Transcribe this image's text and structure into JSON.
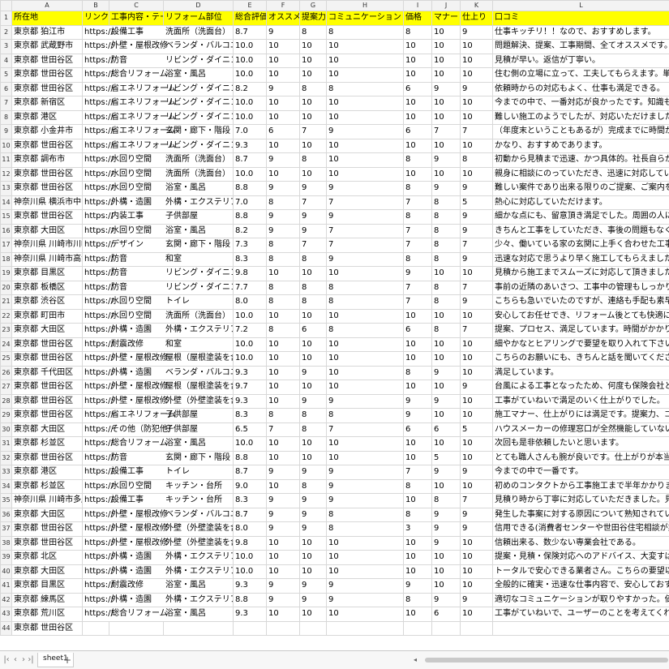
{
  "sheet": {
    "col_letters": [
      "A",
      "B",
      "C",
      "D",
      "E",
      "F",
      "G",
      "H",
      "I",
      "J",
      "K",
      "L"
    ],
    "headers": [
      "所在地",
      "リンク",
      "工事内容・テーマ",
      "リフォーム部位",
      "総合評価",
      "オススメ度",
      "提案力",
      "コミュニケーション",
      "価格",
      "マナー",
      "仕上り",
      "口コミ"
    ],
    "rows": [
      [
        "東京都 狛江市",
        "https://",
        "設備工事",
        "洗面所（洗面台）",
        "8.7",
        "9",
        "8",
        "8",
        "8",
        "10",
        "9",
        "仕事キッチリ！！なので、おすすめします。"
      ],
      [
        "東京都 武蔵野市",
        "https://",
        "外壁・屋根改修",
        "ベランダ・バルコニー",
        "10.0",
        "10",
        "10",
        "10",
        "10",
        "10",
        "10",
        "問題解決、提案、工事期間、全てオススメです。信用出来ます。"
      ],
      [
        "東京都 世田谷区",
        "https://",
        "防音",
        "リビング・ダイニング",
        "10.0",
        "10",
        "10",
        "10",
        "10",
        "10",
        "10",
        "見積が早い。返信が丁寧い。"
      ],
      [
        "東京都 世田谷区",
        "https://",
        "総合リフォーム",
        "浴室・風呂",
        "10.0",
        "10",
        "10",
        "10",
        "10",
        "10",
        "10",
        "住む側の立場に立って、工夫してもらえます。単純に言われたことをやるだけでなく"
      ],
      [
        "東京都 世田谷区",
        "https://",
        "省エネリフォーム",
        "リビング・ダイニング",
        "8.2",
        "9",
        "8",
        "8",
        "6",
        "9",
        "9",
        "依頼時からの対応もよく、仕事も満足できる。"
      ],
      [
        "東京都 新宿区",
        "https://",
        "省エネリフォーム",
        "リビング・ダイニング",
        "10.0",
        "10",
        "10",
        "10",
        "10",
        "10",
        "10",
        "今までの中で、一番対応が良かったです。知識も経験もいっぱいあります。"
      ],
      [
        "東京都 港区",
        "https://",
        "省エネリフォーム",
        "リビング・ダイニング",
        "10.0",
        "10",
        "10",
        "10",
        "10",
        "10",
        "10",
        "難しい施工のようでしたが、対応いただけました。"
      ],
      [
        "東京都 小金井市",
        "https://",
        "省エネリフォーム",
        "玄関・廊下・階段",
        "7.0",
        "6",
        "7",
        "9",
        "6",
        "7",
        "7",
        "（年度末ということもあるが）完成までに時間がかかったため。"
      ],
      [
        "東京都 世田谷区",
        "https://",
        "省エネリフォーム",
        "リビング・ダイニング",
        "9.3",
        "10",
        "10",
        "10",
        "10",
        "10",
        "10",
        "かなり、おすすめであります。"
      ],
      [
        "東京都 調布市",
        "https://",
        "水回り空間",
        "洗面所（洗面台）",
        "8.7",
        "9",
        "8",
        "10",
        "8",
        "9",
        "8",
        "初動から見積まで迅速、かつ具体的。社長自らが営業、見積、現場監督"
      ],
      [
        "東京都 世田谷区",
        "https://",
        "水回り空間",
        "洗面所（洗面台）",
        "10.0",
        "10",
        "10",
        "10",
        "10",
        "10",
        "10",
        "親身に相談にのっていただき、迅速に対応していただいて施工してくれました"
      ],
      [
        "東京都 世田谷区",
        "https://",
        "水回り空間",
        "浴室・風呂",
        "8.8",
        "9",
        "9",
        "9",
        "8",
        "9",
        "9",
        "難しい案件であり出来る限りのご提案、ご案内を頂きました。"
      ],
      [
        "神奈川県 横浜市中区",
        "https://",
        "外構・造園",
        "外構・エクステリア",
        "7.0",
        "8",
        "7",
        "7",
        "7",
        "8",
        "5",
        "熱心に対応していただけます。"
      ],
      [
        "東京都 世田谷区",
        "https://",
        "内装工事",
        "子供部屋",
        "8.8",
        "9",
        "9",
        "9",
        "8",
        "8",
        "9",
        "細かな点にも、留意頂き満足でした。周囲の人にもおすすめできます"
      ],
      [
        "東京都 大田区",
        "https://",
        "水回り空間",
        "浴室・風呂",
        "8.2",
        "9",
        "9",
        "7",
        "7",
        "8",
        "9",
        "きちんと工事をしていただき、事後の問題もなく、とても満足しています。"
      ],
      [
        "神奈川県 川崎市川崎区",
        "https://",
        "デザイン",
        "玄関・廊下・階段",
        "7.3",
        "8",
        "7",
        "7",
        "7",
        "8",
        "7",
        "少々、働いている家の玄関に上手く合わせた工事対応をしていただきまし"
      ],
      [
        "神奈川県 川崎市高津区",
        "https://",
        "防音",
        "和室",
        "8.3",
        "8",
        "8",
        "9",
        "8",
        "8",
        "9",
        "迅速な対応で思うより早く施工してもらえました。"
      ],
      [
        "東京都 目黒区",
        "https://",
        "防音",
        "リビング・ダイニング",
        "9.8",
        "10",
        "10",
        "10",
        "9",
        "10",
        "10",
        "見積から施工までスムーズに対応して頂きました。"
      ],
      [
        "東京都 板橋区",
        "https://",
        "防音",
        "リビング・ダイニング",
        "7.7",
        "8",
        "8",
        "8",
        "7",
        "8",
        "7",
        "事前の近隣のあいさつ、工事中の管理もしっかりやってくれて、オススメ"
      ],
      [
        "東京都 渋谷区",
        "https://",
        "水回り空間",
        "トイレ",
        "8.0",
        "8",
        "8",
        "8",
        "7",
        "8",
        "9",
        "こちらも急いでいたのですが、連絡も手配も素早く対応していただけまし"
      ],
      [
        "東京都 町田市",
        "https://",
        "水回り空間",
        "洗面所（洗面台）",
        "10.0",
        "10",
        "10",
        "10",
        "10",
        "10",
        "10",
        "安心してお任せでき、リフォーム後とても快適に過ごしています。知り"
      ],
      [
        "東京都 大田区",
        "https://",
        "外構・造園",
        "外構・エクステリア",
        "7.2",
        "8",
        "6",
        "8",
        "6",
        "8",
        "7",
        "提案、プロセス、満足しています。時間がかかりすぎたのは、御社の"
      ],
      [
        "東京都 世田谷区",
        "https://",
        "耐震改修",
        "和室",
        "10.0",
        "10",
        "10",
        "10",
        "10",
        "10",
        "10",
        "細やかなとヒアリングで要望を取り入れて下さいました。メリットもデメ"
      ],
      [
        "東京都 世田谷区",
        "https://",
        "外壁・屋根改修",
        "屋根（屋根塗装を含む）",
        "10.0",
        "10",
        "10",
        "10",
        "10",
        "10",
        "10",
        "こちらのお願いにも、きちんと話を聞いてくださり、快く引き受けていた"
      ],
      [
        "東京都 千代田区",
        "https://",
        "外構・造園",
        "ベランダ・バルコニー",
        "9.3",
        "10",
        "9",
        "10",
        "8",
        "9",
        "10",
        "満足しています。"
      ],
      [
        "東京都 世田谷区",
        "https://",
        "外壁・屋根改修",
        "屋根（屋根塗装を含む）",
        "9.7",
        "10",
        "10",
        "10",
        "10",
        "10",
        "9",
        "台風による工事となったため、何度も保険会社と交渉いただいたと伺い"
      ],
      [
        "東京都 世田谷区",
        "https://",
        "外壁・屋根改修",
        "外壁（外壁塗装を含む）",
        "9.3",
        "10",
        "9",
        "9",
        "9",
        "9",
        "10",
        "工事がていねいで満足のいく仕上がりでした。"
      ],
      [
        "東京都 世田谷区",
        "https://",
        "省エネリフォーム",
        "子供部屋",
        "8.3",
        "8",
        "8",
        "8",
        "9",
        "10",
        "10",
        "施工マナー、仕上がりには満足です。提案力、コミュニケーション力"
      ],
      [
        "東京都 大田区",
        "https://",
        "その他（防犯他）",
        "子供部屋",
        "6.5",
        "7",
        "8",
        "7",
        "6",
        "6",
        "5",
        "ハウスメーカーの修理窓口が全然機能していない中、迅速に対応して頂"
      ],
      [
        "東京都 杉並区",
        "https://",
        "総合リフォーム",
        "浴室・風呂",
        "10.0",
        "10",
        "10",
        "10",
        "10",
        "10",
        "10",
        "次回も是非依頼したいと思います。"
      ],
      [
        "東京都 世田谷区",
        "https://",
        "防音",
        "玄関・廊下・階段",
        "8.8",
        "10",
        "10",
        "10",
        "10",
        "5",
        "10",
        "とても職人さんも腕が良いです。仕上がりが本当にきれいです。手先"
      ],
      [
        "東京都 港区",
        "https://",
        "設備工事",
        "トイレ",
        "8.7",
        "9",
        "9",
        "9",
        "7",
        "9",
        "9",
        "今までの中で一番です。"
      ],
      [
        "東京都 杉並区",
        "https://",
        "水回り空間",
        "キッチン・台所",
        "9.0",
        "10",
        "8",
        "9",
        "8",
        "10",
        "10",
        "初めのコンタクトから工事施工まで半年かかりましたが、こちらの要望"
      ],
      [
        "神奈川県 川崎市多摩区",
        "https://",
        "設備工事",
        "キッチン・台所",
        "8.3",
        "9",
        "9",
        "9",
        "10",
        "8",
        "7",
        "見積り時から丁寧に対応していただきました。見積もりの際の我々の"
      ],
      [
        "東京都 大田区",
        "https://",
        "外壁・屋根改修",
        "ベランダ・バルコニー",
        "8.7",
        "9",
        "9",
        "8",
        "8",
        "9",
        "9",
        "発生した事案に対する原因について熟知されていて、的確な指摘をし"
      ],
      [
        "東京都 世田谷区",
        "https://",
        "外壁・屋根改修",
        "外壁（外壁塗装を含む）",
        "8.0",
        "9",
        "9",
        "8",
        "3",
        "9",
        "9",
        "信用できる(消費者センターや世田谷住宅相談が業者さんなので安心です"
      ],
      [
        "東京都 世田谷区",
        "https://",
        "外壁・屋根改修",
        "外壁（外壁塗装を含む）",
        "9.8",
        "10",
        "10",
        "10",
        "10",
        "9",
        "10",
        "信頼出来る、数少ない専業会社である。"
      ],
      [
        "東京都 北区",
        "https://",
        "外構・造園",
        "外構・エクステリア",
        "10.0",
        "10",
        "10",
        "10",
        "10",
        "10",
        "10",
        "提案・見積・保険対応へのアドバイス、大変すばらしく満足しております"
      ],
      [
        "東京都 大田区",
        "https://",
        "外構・造園",
        "外構・エクステリア",
        "10.0",
        "10",
        "10",
        "10",
        "10",
        "10",
        "10",
        "トータルで安心できる業者さん。こちらの要望以上にいろいろな部分を提案して"
      ],
      [
        "東京都 目黒区",
        "https://",
        "耐震改修",
        "浴室・風呂",
        "9.3",
        "9",
        "9",
        "9",
        "9",
        "10",
        "10",
        "全般的に確実・迅速な仕事内容で、安心しておすすめできる業者さん"
      ],
      [
        "東京都 練馬区",
        "https://",
        "外構・造園",
        "外構・エクステリア",
        "8.8",
        "9",
        "9",
        "9",
        "8",
        "9",
        "9",
        "適切なコミュニケーションが取りやすかった。価格が明瞭で、良心的でした"
      ],
      [
        "東京都 荒川区",
        "https://",
        "総合リフォーム",
        "浴室・風呂",
        "9.3",
        "10",
        "10",
        "10",
        "10",
        "6",
        "10",
        "工事がていねいで、ユーザーのことを考えてくれる。"
      ]
    ],
    "partial_last_row": "東京都 世田谷区"
  },
  "statusbar": {
    "sheet_tab": "sheet1",
    "add_tab": "+",
    "nav_first": "|‹",
    "nav_prev": "‹",
    "nav_next": "›",
    "nav_last": "›|",
    "scroll_arrow": "◂"
  }
}
